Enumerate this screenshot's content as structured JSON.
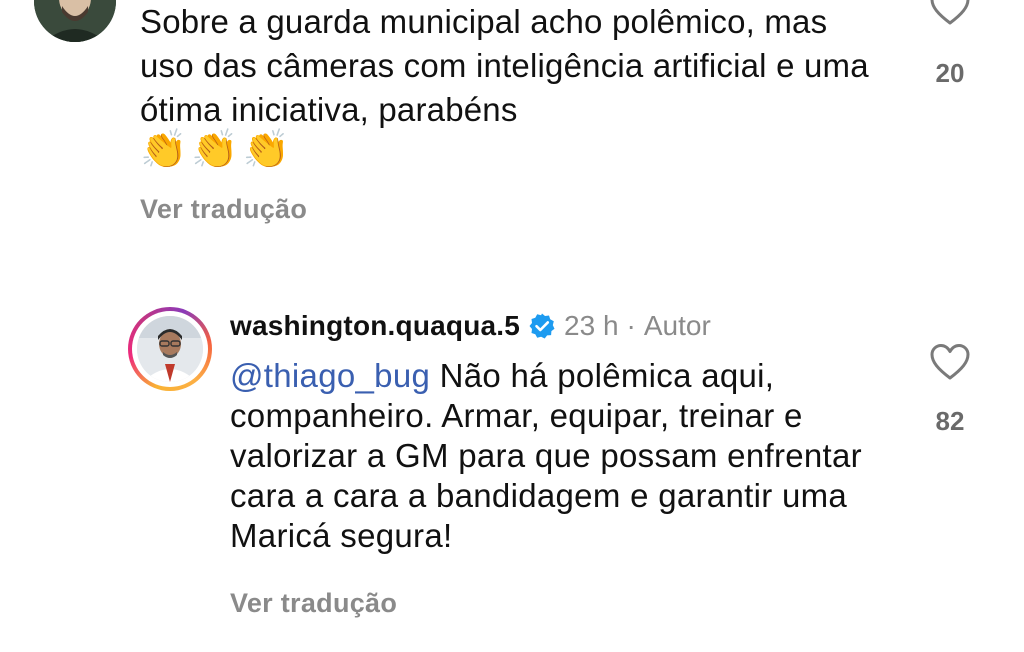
{
  "comment1": {
    "text": "Sobre a guarda municipal acho polêmico, mas uso das câmeras com inteligência artificial e uma ótima iniciativa, parabéns",
    "emojis": [
      "👏",
      "👏",
      "👏"
    ],
    "see_translation": "Ver tradução",
    "like_count": "20"
  },
  "reply": {
    "username": "washington.quaqua.5",
    "time": "23 h",
    "separator": "·",
    "author_label": "Autor",
    "mention": "@thiago_bug",
    "text": " Não há polêmica aqui, companheiro. Armar, equipar, treinar e valorizar a GM para que possam enfrentar cara a cara a bandidagem e garantir uma Maricá segura!",
    "see_translation": "Ver tradução",
    "like_count": "82"
  },
  "icons": {
    "heart": "heart-outline-icon",
    "verified": "verified-badge-icon"
  },
  "colors": {
    "mention": "#3a5fb0",
    "verified": "#1d9bf0",
    "muted": "#8a8a8a"
  }
}
